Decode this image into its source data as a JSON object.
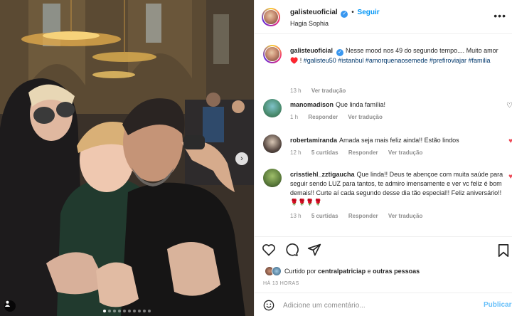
{
  "header": {
    "username": "galisteuoficial",
    "follow_separator": "•",
    "follow_label": "Seguir",
    "location": "Hagia Sophia",
    "more_icon": "ellipsis-icon"
  },
  "caption": {
    "username": "galisteuoficial",
    "text": "Nesse mood nos 49 do segundo tempo.... Muito amor ♥️ !",
    "hashtags": [
      "#galisteu50",
      "#istanbul",
      "#amorquenaosemede",
      "#prefiroviajar",
      "#familia"
    ],
    "time": "13 h",
    "translate": "Ver tradução"
  },
  "comments": [
    {
      "username": "manomadison",
      "text": "Que linda família!",
      "time": "1 h",
      "likes": "",
      "reply": "Responder",
      "translate": "Ver tradução",
      "liked": false
    },
    {
      "username": "robertamiranda",
      "text": "Amada seja mais feliz ainda!! Estão lindos",
      "time": "12 h",
      "likes": "5 curtidas",
      "reply": "Responder",
      "translate": "Ver tradução",
      "liked": true
    },
    {
      "username": "crisstiehl_zztigaucha",
      "text": "Que linda!! Deus te abençoe com muita saúde para seguir sendo LUZ para tantos, te admiro imensamente e ver vc feliz é bom demais!! Curte aí cada segundo desse dia tão especial!! Feliz aniversário!! 🌹🌹🌹🌹",
      "time": "13 h",
      "likes": "5 curtidas",
      "reply": "Responder",
      "translate": "Ver tradução",
      "liked": true
    }
  ],
  "likes": {
    "prefix": "Curtido por",
    "user": "centralpatriciap",
    "conjunction": "e",
    "others": "outras pessoas"
  },
  "post_time": "HÁ 13 HORAS",
  "add_comment": {
    "placeholder": "Adicione um comentário...",
    "publish_label": "Publicar"
  },
  "carousel": {
    "slide_count": 10,
    "active_index": 0
  },
  "colors": {
    "accent": "#0095f6",
    "heart": "#ed4956",
    "verified": "#3897f0"
  }
}
